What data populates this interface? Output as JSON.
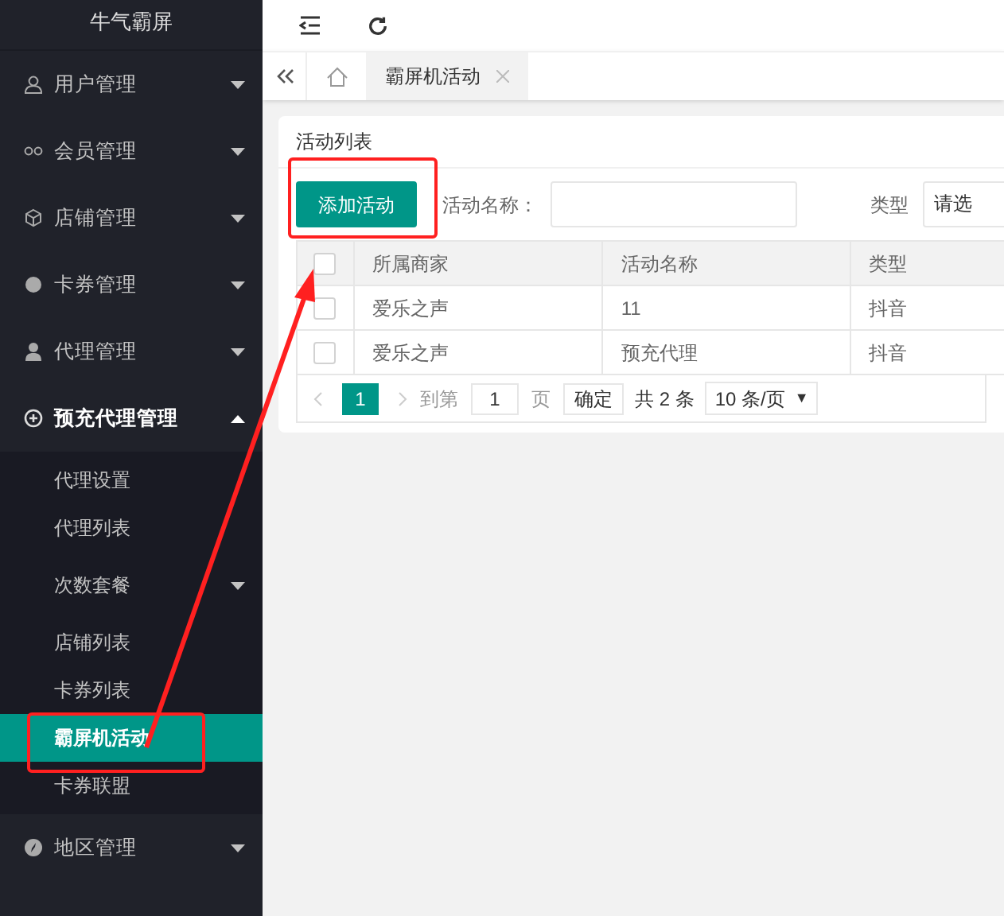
{
  "logo": "牛气霸屏",
  "menu": [
    {
      "label": "用户管理",
      "expanded": false
    },
    {
      "label": "会员管理",
      "expanded": false
    },
    {
      "label": "店铺管理",
      "expanded": false
    },
    {
      "label": "卡券管理",
      "expanded": false
    },
    {
      "label": "代理管理",
      "expanded": false
    },
    {
      "label": "预充代理管理",
      "expanded": true,
      "children": [
        {
          "label": "代理设置",
          "selected": false
        },
        {
          "label": "代理列表",
          "selected": false
        },
        {
          "label": "次数套餐",
          "selected": false,
          "expanded": false
        },
        {
          "label": "店铺列表",
          "selected": false
        },
        {
          "label": "卡券列表",
          "selected": false
        },
        {
          "label": "霸屏机活动",
          "selected": true
        },
        {
          "label": "卡券联盟",
          "selected": false
        }
      ]
    },
    {
      "label": "地区管理",
      "expanded": false
    }
  ],
  "tabs": [
    {
      "label": "霸屏机活动",
      "selected": true
    }
  ],
  "card_title": "活动列表",
  "add_button": "添加活动",
  "filters": [
    {
      "label": "活动名称：",
      "kind": "input"
    },
    {
      "label": "类型",
      "kind": "select",
      "placeholder": "请选"
    }
  ],
  "table": {
    "all_checked": false,
    "columns": [
      "所属商家",
      "活动名称",
      "类型"
    ],
    "rows": [
      {
        "checked": false,
        "cells": [
          "爱乐之声",
          "11",
          "抖音"
        ]
      },
      {
        "checked": false,
        "cells": [
          "爱乐之声",
          "预充代理",
          "抖音"
        ]
      }
    ]
  },
  "pagination": {
    "current": "1",
    "goto_label": "到第",
    "goto_value": "1",
    "page_label": "页",
    "confirm": "确定",
    "total": "共 2 条",
    "page_size": "10 条/页",
    "caret": "▼"
  }
}
